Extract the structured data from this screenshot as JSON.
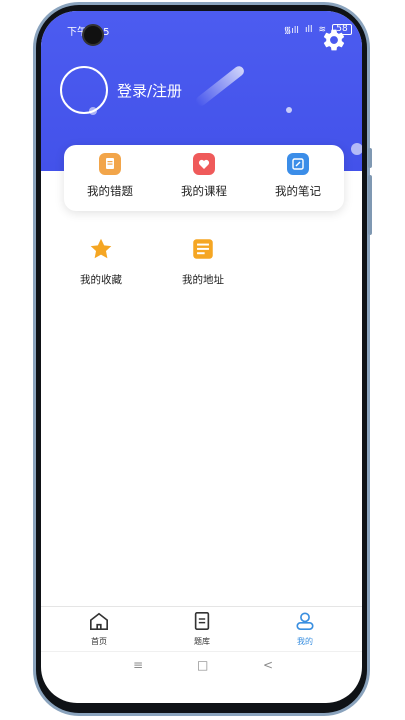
{
  "status_bar": {
    "time": "下午1:45",
    "signal1": "᯾ıll",
    "signal2": "ıll",
    "wifi": "≋",
    "battery": "58"
  },
  "profile": {
    "login_label": "登录/注册"
  },
  "quick_actions": [
    {
      "label": "我的错题",
      "icon": "document-icon",
      "color": "#f2a54a"
    },
    {
      "label": "我的课程",
      "icon": "heart-icon",
      "color": "#ef5a5a"
    },
    {
      "label": "我的笔记",
      "icon": "note-icon",
      "color": "#3b8de8"
    }
  ],
  "grid": [
    {
      "label": "我的收藏",
      "icon": "star-icon",
      "color": "#f5a623"
    },
    {
      "label": "我的地址",
      "icon": "list-doc-icon",
      "color": "#f5a623"
    }
  ],
  "tabs": [
    {
      "label": "首页",
      "icon": "home-icon"
    },
    {
      "label": "题库",
      "icon": "question-bank-icon"
    },
    {
      "label": "我的",
      "icon": "profile-icon"
    }
  ],
  "nav": {
    "menu": "≡",
    "home": "□",
    "back": "<"
  },
  "colors": {
    "header": "#4c5cf0",
    "active_tab": "#3a8fe0"
  }
}
